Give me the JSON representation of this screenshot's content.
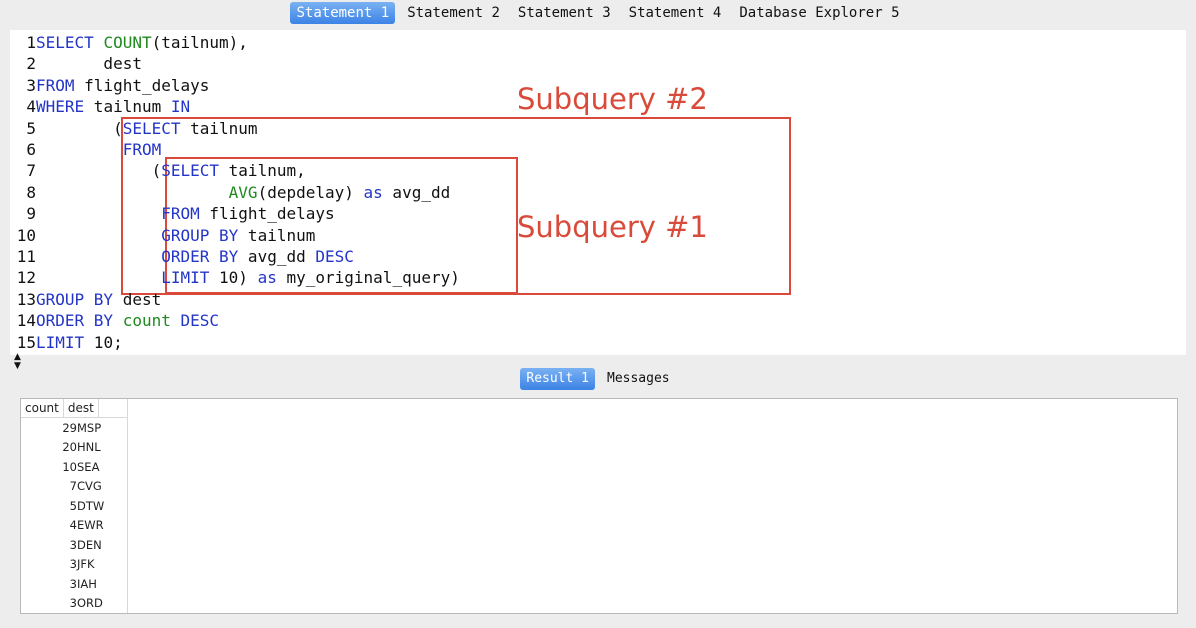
{
  "tabs": [
    "Statement 1",
    "Statement 2",
    "Statement 3",
    "Statement 4",
    "Database Explorer 5"
  ],
  "active_tab": 0,
  "editor": {
    "lines": [
      {
        "n": "1",
        "parts": [
          [
            "kw",
            "SELECT "
          ],
          [
            "fn",
            "COUNT"
          ],
          [
            "c",
            "(tailnum),"
          ]
        ]
      },
      {
        "n": "2",
        "parts": [
          [
            "c",
            "       dest"
          ]
        ]
      },
      {
        "n": "3",
        "parts": [
          [
            "kw",
            "FROM"
          ],
          [
            "c",
            " flight_delays"
          ]
        ]
      },
      {
        "n": "4",
        "parts": [
          [
            "kw",
            "WHERE"
          ],
          [
            "c",
            " tailnum "
          ],
          [
            "kw",
            "IN"
          ]
        ]
      },
      {
        "n": "5",
        "parts": [
          [
            "c",
            "        ("
          ],
          [
            "kw",
            "SELECT"
          ],
          [
            "c",
            " tailnum"
          ]
        ]
      },
      {
        "n": "6",
        "parts": [
          [
            "c",
            "         "
          ],
          [
            "kw",
            "FROM"
          ]
        ]
      },
      {
        "n": "7",
        "parts": [
          [
            "c",
            "            ("
          ],
          [
            "kw",
            "SELECT"
          ],
          [
            "c",
            " tailnum,"
          ]
        ]
      },
      {
        "n": "8",
        "parts": [
          [
            "c",
            "                    "
          ],
          [
            "fn",
            "AVG"
          ],
          [
            "c",
            "(depdelay) "
          ],
          [
            "kw",
            "as"
          ],
          [
            "c",
            " avg_dd"
          ]
        ]
      },
      {
        "n": "9",
        "parts": [
          [
            "c",
            "             "
          ],
          [
            "kw",
            "FROM"
          ],
          [
            "c",
            " flight_delays"
          ]
        ]
      },
      {
        "n": "10",
        "parts": [
          [
            "c",
            "             "
          ],
          [
            "kw",
            "GROUP BY"
          ],
          [
            "c",
            " tailnum"
          ]
        ]
      },
      {
        "n": "11",
        "parts": [
          [
            "c",
            "             "
          ],
          [
            "kw",
            "ORDER BY"
          ],
          [
            "c",
            " avg_dd "
          ],
          [
            "kw",
            "DESC"
          ]
        ]
      },
      {
        "n": "12",
        "parts": [
          [
            "c",
            "             "
          ],
          [
            "kw",
            "LIMIT"
          ],
          [
            "c",
            " 10) "
          ],
          [
            "kw",
            "as"
          ],
          [
            "c",
            " my_original_query)"
          ]
        ]
      },
      {
        "n": "13",
        "parts": [
          [
            "kw",
            "GROUP BY"
          ],
          [
            "c",
            " dest"
          ]
        ]
      },
      {
        "n": "14",
        "parts": [
          [
            "kw",
            "ORDER BY"
          ],
          [
            "c",
            " "
          ],
          [
            "fn",
            "count"
          ],
          [
            "c",
            " "
          ],
          [
            "kw",
            "DESC"
          ]
        ]
      },
      {
        "n": "15",
        "parts": [
          [
            "kw",
            "LIMIT"
          ],
          [
            "c",
            " 10;"
          ]
        ]
      }
    ]
  },
  "annotations": {
    "subquery2": "Subquery #2",
    "subquery1": "Subquery #1",
    "color": "#d94a3a"
  },
  "result_tabs": [
    "Result 1",
    "Messages"
  ],
  "active_result_tab": 0,
  "results": {
    "columns": [
      "count",
      "dest"
    ],
    "rows": [
      [
        "29",
        "MSP"
      ],
      [
        "20",
        "HNL"
      ],
      [
        "10",
        "SEA"
      ],
      [
        "7",
        "CVG"
      ],
      [
        "5",
        "DTW"
      ],
      [
        "4",
        "EWR"
      ],
      [
        "3",
        "DEN"
      ],
      [
        "3",
        "JFK"
      ],
      [
        "3",
        "IAH"
      ],
      [
        "3",
        "ORD"
      ]
    ]
  }
}
